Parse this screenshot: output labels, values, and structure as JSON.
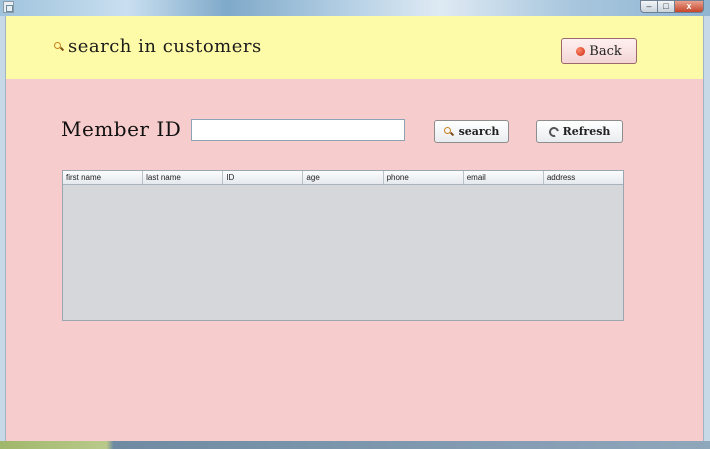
{
  "window": {
    "controls": {
      "minimize": "–",
      "maximize": "□",
      "close": "x"
    }
  },
  "header": {
    "title": "search in customers",
    "title_icon": "search-icon",
    "back_label": "Back",
    "back_icon": "back-icon"
  },
  "form": {
    "member_label": "Member ID",
    "member_value": "",
    "search_label": "search",
    "search_icon": "search-icon",
    "refresh_label": "Refresh",
    "refresh_icon": "refresh-icon"
  },
  "table": {
    "columns": [
      "first name",
      "last name",
      "ID",
      "age",
      "phone",
      "email",
      "address"
    ],
    "rows": []
  },
  "colors": {
    "header_bg": "#fefba8",
    "content_bg": "#f6cccc",
    "table_bg": "#d5d7db"
  }
}
